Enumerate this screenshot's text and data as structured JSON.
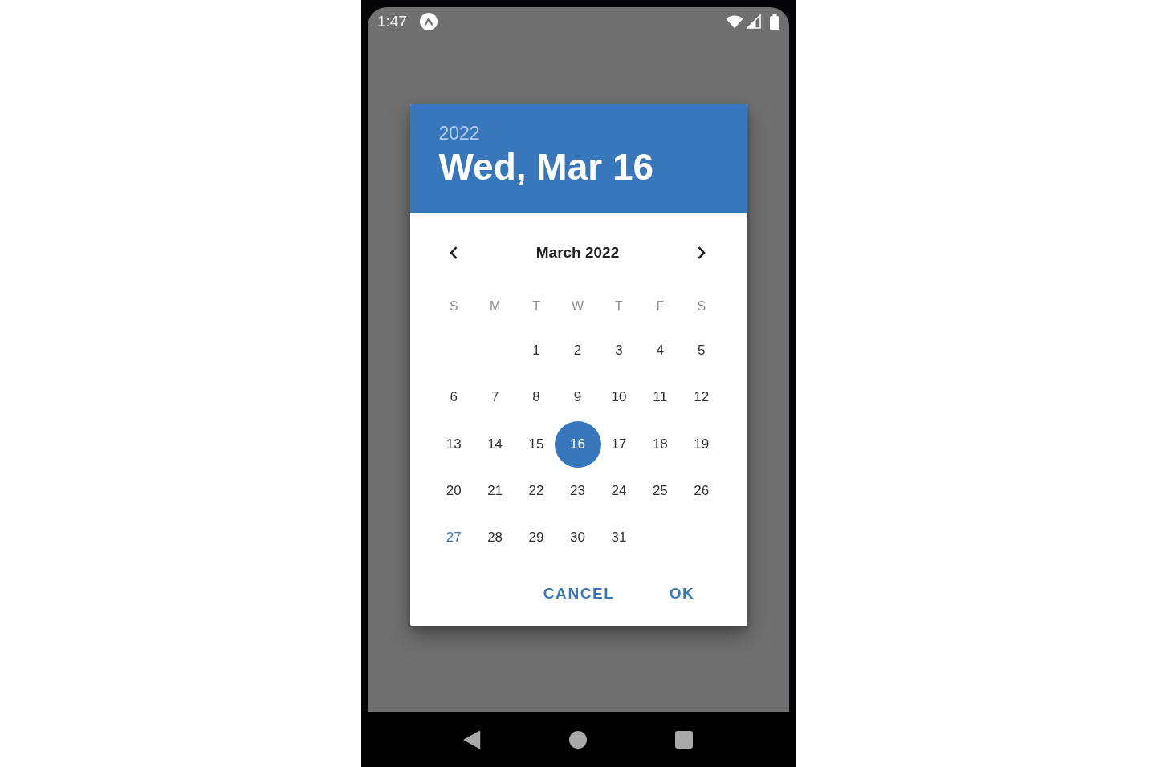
{
  "status_bar": {
    "time": "1:47"
  },
  "dialog": {
    "header": {
      "year": {
        "label": "2022",
        "selected": false
      },
      "date": {
        "label": "Wed, Mar 16",
        "selected": true
      }
    },
    "month_label": "March 2022",
    "weekdays": [
      "S",
      "M",
      "T",
      "W",
      "T",
      "F",
      "S"
    ],
    "weeks": [
      {
        "days": [
          {
            "kind": "blank"
          },
          {
            "kind": "blank"
          },
          {
            "kind": "day",
            "label": "1",
            "selected": false,
            "today": false
          },
          {
            "kind": "day",
            "label": "2",
            "selected": false,
            "today": false
          },
          {
            "kind": "day",
            "label": "3",
            "selected": false,
            "today": false
          },
          {
            "kind": "day",
            "label": "4",
            "selected": false,
            "today": false
          },
          {
            "kind": "day",
            "label": "5",
            "selected": false,
            "today": false
          }
        ]
      },
      {
        "days": [
          {
            "kind": "day",
            "label": "6",
            "selected": false,
            "today": false
          },
          {
            "kind": "day",
            "label": "7",
            "selected": false,
            "today": false
          },
          {
            "kind": "day",
            "label": "8",
            "selected": false,
            "today": false
          },
          {
            "kind": "day",
            "label": "9",
            "selected": false,
            "today": false
          },
          {
            "kind": "day",
            "label": "10",
            "selected": false,
            "today": false
          },
          {
            "kind": "day",
            "label": "11",
            "selected": false,
            "today": false
          },
          {
            "kind": "day",
            "label": "12",
            "selected": false,
            "today": false
          }
        ]
      },
      {
        "days": [
          {
            "kind": "day",
            "label": "13",
            "selected": false,
            "today": false
          },
          {
            "kind": "day",
            "label": "14",
            "selected": false,
            "today": false
          },
          {
            "kind": "day",
            "label": "15",
            "selected": false,
            "today": false
          },
          {
            "kind": "day",
            "label": "16",
            "selected": true,
            "today": false
          },
          {
            "kind": "day",
            "label": "17",
            "selected": false,
            "today": false
          },
          {
            "kind": "day",
            "label": "18",
            "selected": false,
            "today": false
          },
          {
            "kind": "day",
            "label": "19",
            "selected": false,
            "today": false
          }
        ]
      },
      {
        "days": [
          {
            "kind": "day",
            "label": "20",
            "selected": false,
            "today": false
          },
          {
            "kind": "day",
            "label": "21",
            "selected": false,
            "today": false
          },
          {
            "kind": "day",
            "label": "22",
            "selected": false,
            "today": false
          },
          {
            "kind": "day",
            "label": "23",
            "selected": false,
            "today": false
          },
          {
            "kind": "day",
            "label": "24",
            "selected": false,
            "today": false
          },
          {
            "kind": "day",
            "label": "25",
            "selected": false,
            "today": false
          },
          {
            "kind": "day",
            "label": "26",
            "selected": false,
            "today": false
          }
        ]
      },
      {
        "days": [
          {
            "kind": "day",
            "label": "27",
            "selected": false,
            "today": true
          },
          {
            "kind": "day",
            "label": "28",
            "selected": false,
            "today": false
          },
          {
            "kind": "day",
            "label": "29",
            "selected": false,
            "today": false
          },
          {
            "kind": "day",
            "label": "30",
            "selected": false,
            "today": false
          },
          {
            "kind": "day",
            "label": "31",
            "selected": false,
            "today": false
          },
          {
            "kind": "blank"
          },
          {
            "kind": "blank"
          }
        ]
      }
    ],
    "buttons": [
      "CANCEL",
      "OK"
    ]
  }
}
